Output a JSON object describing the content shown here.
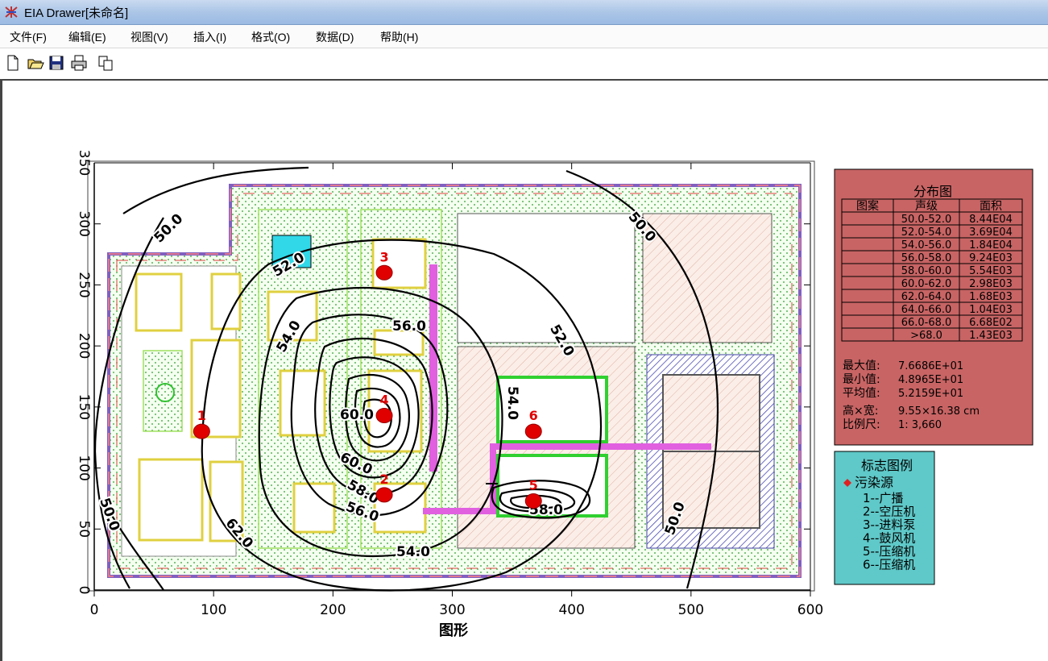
{
  "window": {
    "title": "EIA Drawer[未命名]"
  },
  "menu": [
    {
      "label": "文件(F)"
    },
    {
      "label": "编辑(E)"
    },
    {
      "label": "视图(V)"
    },
    {
      "label": "插入(I)"
    },
    {
      "label": "格式(O)"
    },
    {
      "label": "数据(D)"
    },
    {
      "label": "帮助(H)"
    }
  ],
  "toolbar": {
    "buttons": [
      "new-icon",
      "open-icon",
      "save-icon",
      "print-icon",
      "copy-icon"
    ]
  },
  "chart_data": {
    "type": "contour",
    "xlabel": "图形",
    "xticks": [
      0,
      100,
      200,
      300,
      400,
      500,
      600
    ],
    "yticks": [
      0,
      50,
      100,
      150,
      200,
      250,
      300,
      350
    ],
    "xlim": [
      0,
      600
    ],
    "ylim": [
      0,
      350
    ],
    "contour_labels": [
      "50.0",
      "52.0",
      "54.0",
      "56.0",
      "58.0",
      "60.0",
      "62.0"
    ],
    "sources": [
      {
        "id": "1",
        "x": 90,
        "y": 130
      },
      {
        "id": "2",
        "x": 243,
        "y": 78
      },
      {
        "id": "3",
        "x": 243,
        "y": 260
      },
      {
        "id": "4",
        "x": 243,
        "y": 143
      },
      {
        "id": "5",
        "x": 368,
        "y": 73
      },
      {
        "id": "6",
        "x": 368,
        "y": 130
      }
    ]
  },
  "legend_table": {
    "title": "分布图",
    "headers": [
      "图案",
      "声级",
      "面积"
    ],
    "rows": [
      {
        "range": "50.0-52.0",
        "area": "8.44E04"
      },
      {
        "range": "52.0-54.0",
        "area": "3.69E04"
      },
      {
        "range": "54.0-56.0",
        "area": "1.84E04"
      },
      {
        "range": "56.0-58.0",
        "area": "9.24E03"
      },
      {
        "range": "58.0-60.0",
        "area": "5.54E03"
      },
      {
        "range": "60.0-62.0",
        "area": "2.98E03"
      },
      {
        "range": "62.0-64.0",
        "area": "1.68E03"
      },
      {
        "range": "64.0-66.0",
        "area": "1.04E03"
      },
      {
        "range": "66.0-68.0",
        "area": "6.68E02"
      },
      {
        "range": ">68.0",
        "area": "1.43E03"
      }
    ],
    "stats": [
      {
        "label": "最大值:",
        "value": "7.6686E+01"
      },
      {
        "label": "最小值:",
        "value": "4.8965E+01"
      },
      {
        "label": "平均值:",
        "value": "5.2159E+01"
      },
      {
        "label": "高×宽:",
        "value": "9.55×16.38 cm"
      },
      {
        "label": "比例尺:",
        "value": "1: 3,660"
      }
    ],
    "bg_color": "#c86464"
  },
  "marker_legend": {
    "title": "标志图例",
    "category": "污染源",
    "items": [
      "1--广播",
      "2--空压机",
      "3--进料泵",
      "4--鼓风机",
      "5--压缩机",
      "6--压缩机"
    ],
    "bg_color": "#5fc8c8"
  }
}
